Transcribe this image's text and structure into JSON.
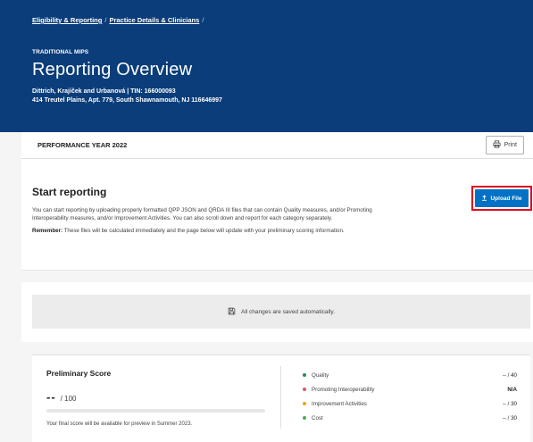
{
  "header": {
    "breadcrumbs": [
      "Eligibility & Reporting",
      "Practice Details & Clinicians"
    ],
    "breadcrumb_separator": "/",
    "program": "TRADITIONAL MIPS",
    "title": "Reporting Overview",
    "practice": "Dittrich, Krajíček and Urbanová | TIN: 166000093",
    "address": "414 Treutel Plains, Apt. 779, South Shawnamouth, NJ 116646997"
  },
  "performance": {
    "year_label": "PERFORMANCE YEAR 2022",
    "print_label": "Print"
  },
  "start": {
    "title": "Start reporting",
    "description": "You can start reporting by uploading properly formatted QPP JSON and QRDA III files that can contain Quality measures, and/or Promoting Interoperability measures, and/or Improvement Activities. You can also scroll down and report for each category separately.",
    "note_label": "Remember:",
    "note_text": "These files will be calculated immediately and the page below will update with your preliminary scoring information.",
    "upload_label": "Upload File"
  },
  "autosave": {
    "text": "All changes are saved automatically."
  },
  "score": {
    "title": "Preliminary Score",
    "value": "--",
    "denominator": "/ 100",
    "progress": 0,
    "footnote": "Your final score will be available for preview in Summer 2023.",
    "categories": [
      {
        "name": "Quality",
        "value": "-- / 40",
        "color": "#2e8b57"
      },
      {
        "name": "Promoting Interoperability",
        "value": "N/A",
        "color": "#e0556b"
      },
      {
        "name": "Improvement Activities",
        "value": "-- / 30",
        "color": "#f0a51e"
      },
      {
        "name": "Cost",
        "value": "-- / 30",
        "color": "#4caf50"
      }
    ]
  },
  "colors": {
    "header_bg": "#0a3d7a",
    "accent": "#0071c5",
    "highlight": "#e3001b"
  }
}
